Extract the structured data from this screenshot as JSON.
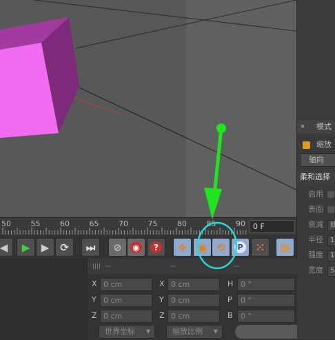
{
  "right_panel": {
    "tab_label": "模式",
    "object_label": "缩放",
    "axis_button": "轴向",
    "section_title": "柔和选择",
    "props": [
      {
        "label": "启用",
        "kind": "check"
      },
      {
        "label": "表面",
        "kind": "check"
      },
      {
        "label": "衰减",
        "kind": "field",
        "value": "线"
      },
      {
        "label": "半径",
        "kind": "field",
        "value": "1"
      },
      {
        "label": "强度",
        "kind": "field",
        "value": "1"
      },
      {
        "label": "宽度",
        "kind": "field",
        "value": "5"
      }
    ]
  },
  "timeline": {
    "ticks": [
      "50",
      "55",
      "60",
      "65",
      "70",
      "75",
      "80",
      "85",
      "90"
    ],
    "frame": "0 F"
  },
  "toolbar": {
    "buttons": [
      {
        "name": "go-previous-frame-icon"
      },
      {
        "name": "play-icon"
      },
      {
        "name": "go-next-frame-icon"
      },
      {
        "name": "loop-icon"
      },
      {
        "name": "go-to-end-icon"
      },
      {
        "name": "record-key-icon"
      },
      {
        "name": "autokey-icon"
      },
      {
        "name": "help-icon"
      },
      {
        "name": "move-icon"
      },
      {
        "name": "scale-key-icon"
      },
      {
        "name": "rotate-key-icon"
      },
      {
        "name": "param-key-icon"
      },
      {
        "name": "point-grid-icon"
      },
      {
        "name": "film-icon"
      }
    ]
  },
  "attributes": {
    "header": [
      "--",
      "--",
      "--"
    ],
    "rows": [
      {
        "a_label": "X",
        "a_val": "0 cm",
        "b_label": "X",
        "b_val": "0 cm",
        "c_label": "H",
        "c_val": "0 °"
      },
      {
        "a_label": "Y",
        "a_val": "0 cm",
        "b_label": "Y",
        "b_val": "0 cm",
        "c_label": "P",
        "c_val": "0 °"
      },
      {
        "a_label": "Z",
        "a_val": "0 cm",
        "b_label": "Z",
        "b_val": "0 cm",
        "c_label": "B",
        "c_val": "0 °"
      }
    ],
    "coord_mode": "世界坐标",
    "scale_mode": "缩放比例"
  },
  "colors": {
    "cube_front": "#f16cf0",
    "cube_side": "#7e2a7a",
    "cube_top": "#a33aa0",
    "arrow": "#1fe51f",
    "highlight_circle": "#2ad8d8"
  }
}
